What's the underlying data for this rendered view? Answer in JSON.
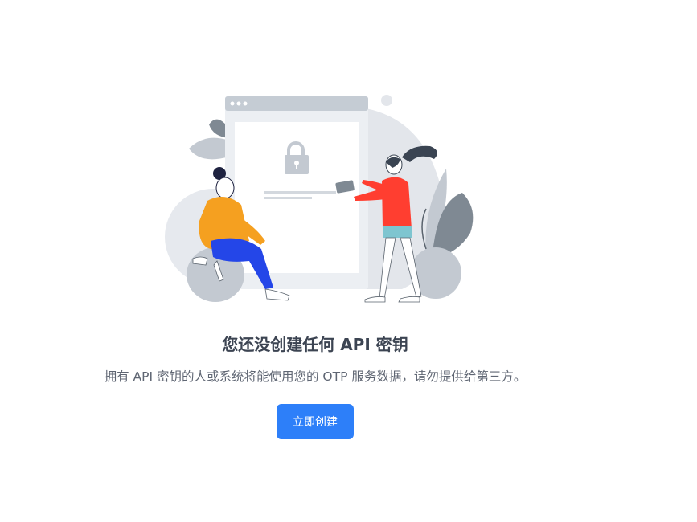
{
  "empty_state": {
    "title": "您还没创建任何 API 密钥",
    "description": "拥有 API 密钥的人或系统将能使用您的 OTP 服务数据，请勿提供给第三方。",
    "create_button_label": "立即创建"
  },
  "colors": {
    "accent": "#2d7ff9",
    "title_text": "#3c4452",
    "body_text": "#5f6673"
  },
  "icons": [
    "lock-icon"
  ]
}
